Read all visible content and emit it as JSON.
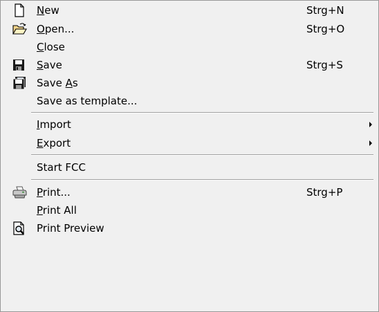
{
  "menu": {
    "new": {
      "pre": "",
      "u": "N",
      "post": "ew",
      "shortcut": "Strg+N",
      "icon": "new-document-icon"
    },
    "open": {
      "pre": "",
      "u": "O",
      "post": "pen...",
      "shortcut": "Strg+O",
      "icon": "open-folder-icon"
    },
    "close": {
      "pre": "",
      "u": "C",
      "post": "lose"
    },
    "save": {
      "pre": "",
      "u": "S",
      "post": "ave",
      "shortcut": "Strg+S",
      "icon": "floppy-disk-icon"
    },
    "save_as": {
      "pre": "Save ",
      "u": "A",
      "post": "s",
      "icon": "save-as-icon"
    },
    "save_template": {
      "label": "Save as template..."
    },
    "import": {
      "pre": "",
      "u": "I",
      "post": "mport"
    },
    "export": {
      "pre": "",
      "u": "E",
      "post": "xport"
    },
    "start_fcc": {
      "label": "Start FCC"
    },
    "print": {
      "pre": "",
      "u": "P",
      "post": "rint...",
      "shortcut": "Strg+P",
      "icon": "printer-icon"
    },
    "print_all": {
      "pre": "",
      "u": "P",
      "post": "rint All"
    },
    "print_preview": {
      "label": "Print Preview",
      "icon": "print-preview-icon"
    }
  }
}
